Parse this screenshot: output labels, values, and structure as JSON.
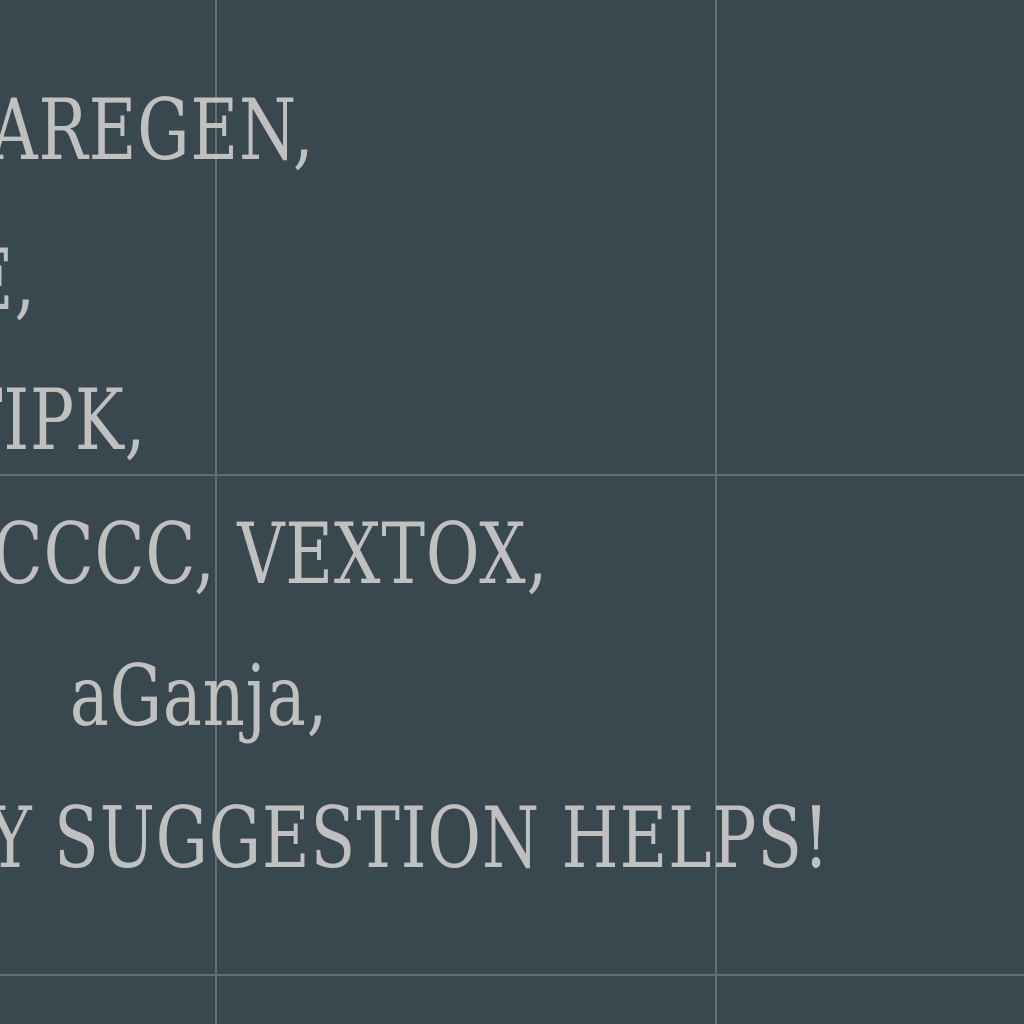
{
  "lines": [
    "AREGEN,",
    "E,",
    "TIPK,",
    "CCCC, VEXTOX,",
    "aGanja,",
    "Y SUGGESTION HELPS!"
  ]
}
